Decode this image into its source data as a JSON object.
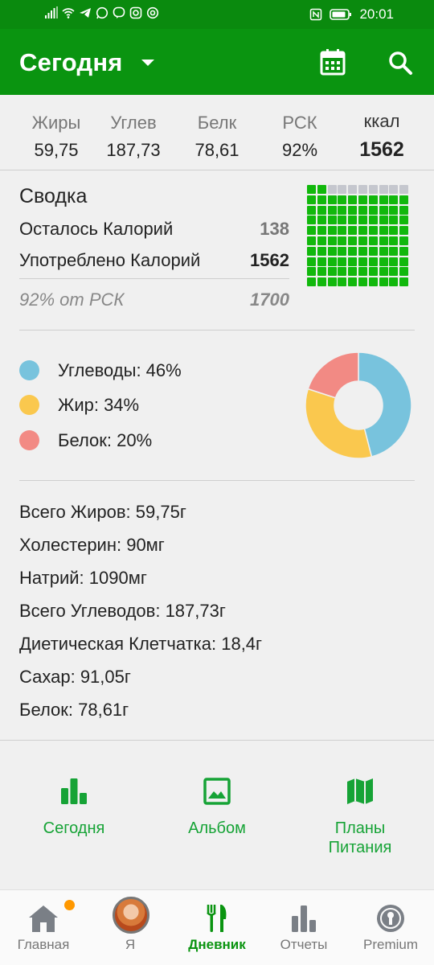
{
  "status_bar": {
    "time": "20:01",
    "icons": [
      "signal-icon",
      "wifi-icon",
      "telegram-icon",
      "whatsapp-icon",
      "viber-icon",
      "instagram-icon",
      "at-icon",
      "nfc-icon",
      "battery-icon"
    ]
  },
  "app_bar": {
    "title": "Сегодня",
    "icons": [
      "dropdown-icon",
      "calendar-icon",
      "search-icon"
    ]
  },
  "macros_header": {
    "fat": {
      "label": "Жиры",
      "value": "59,75"
    },
    "carbs": {
      "label": "Углев",
      "value": "187,73"
    },
    "protein": {
      "label": "Белк",
      "value": "78,61"
    },
    "rdi": {
      "label": "РСК",
      "value": "92%"
    },
    "kcal": {
      "label": "ккал",
      "value": "1562"
    }
  },
  "summary": {
    "heading": "Сводка",
    "remaining_label": "Осталось Калорий",
    "remaining_value": "138",
    "consumed_label": "Употреблено Калорий",
    "consumed_value": "1562",
    "percent_label": "92% от РСК",
    "percent_value": "1700",
    "grid": {
      "total_cells": 100,
      "filled_cells": 92,
      "filled_color": "#11b80c",
      "empty_color": "#c5c7ce"
    }
  },
  "macro_breakdown": {
    "items": [
      {
        "label": "Углеводы: 46%",
        "percent": 46,
        "color": "#78c3dd"
      },
      {
        "label": "Жир: 34%",
        "percent": 34,
        "color": "#fac84e"
      },
      {
        "label": "Белок: 20%",
        "percent": 20,
        "color": "#f28a84"
      }
    ]
  },
  "nutrients": [
    "Всего Жиров: 59,75г",
    "Холестерин: 90мг",
    "Натрий: 1090мг",
    "Всего Углеводов: 187,73г",
    "Диетическая Клетчатка: 18,4г",
    "Сахар: 91,05г",
    "Белок: 78,61г"
  ],
  "quick_actions": [
    {
      "label": "Сегодня",
      "icon": "bar-chart-icon"
    },
    {
      "label": "Альбом",
      "icon": "image-icon"
    },
    {
      "label": "Планы Питания",
      "icon": "map-icon"
    }
  ],
  "bottom_nav": {
    "items": [
      {
        "label": "Главная",
        "icon": "home-icon"
      },
      {
        "label": "Я",
        "icon": "avatar"
      },
      {
        "label": "Дневник",
        "icon": "cutlery-icon",
        "active": true
      },
      {
        "label": "Отчеты",
        "icon": "reports-icon"
      },
      {
        "label": "Premium",
        "icon": "premium-icon"
      }
    ]
  },
  "colors": {
    "primary": "#0a9410",
    "accent": "#16a336",
    "badge": "#ff9800"
  }
}
